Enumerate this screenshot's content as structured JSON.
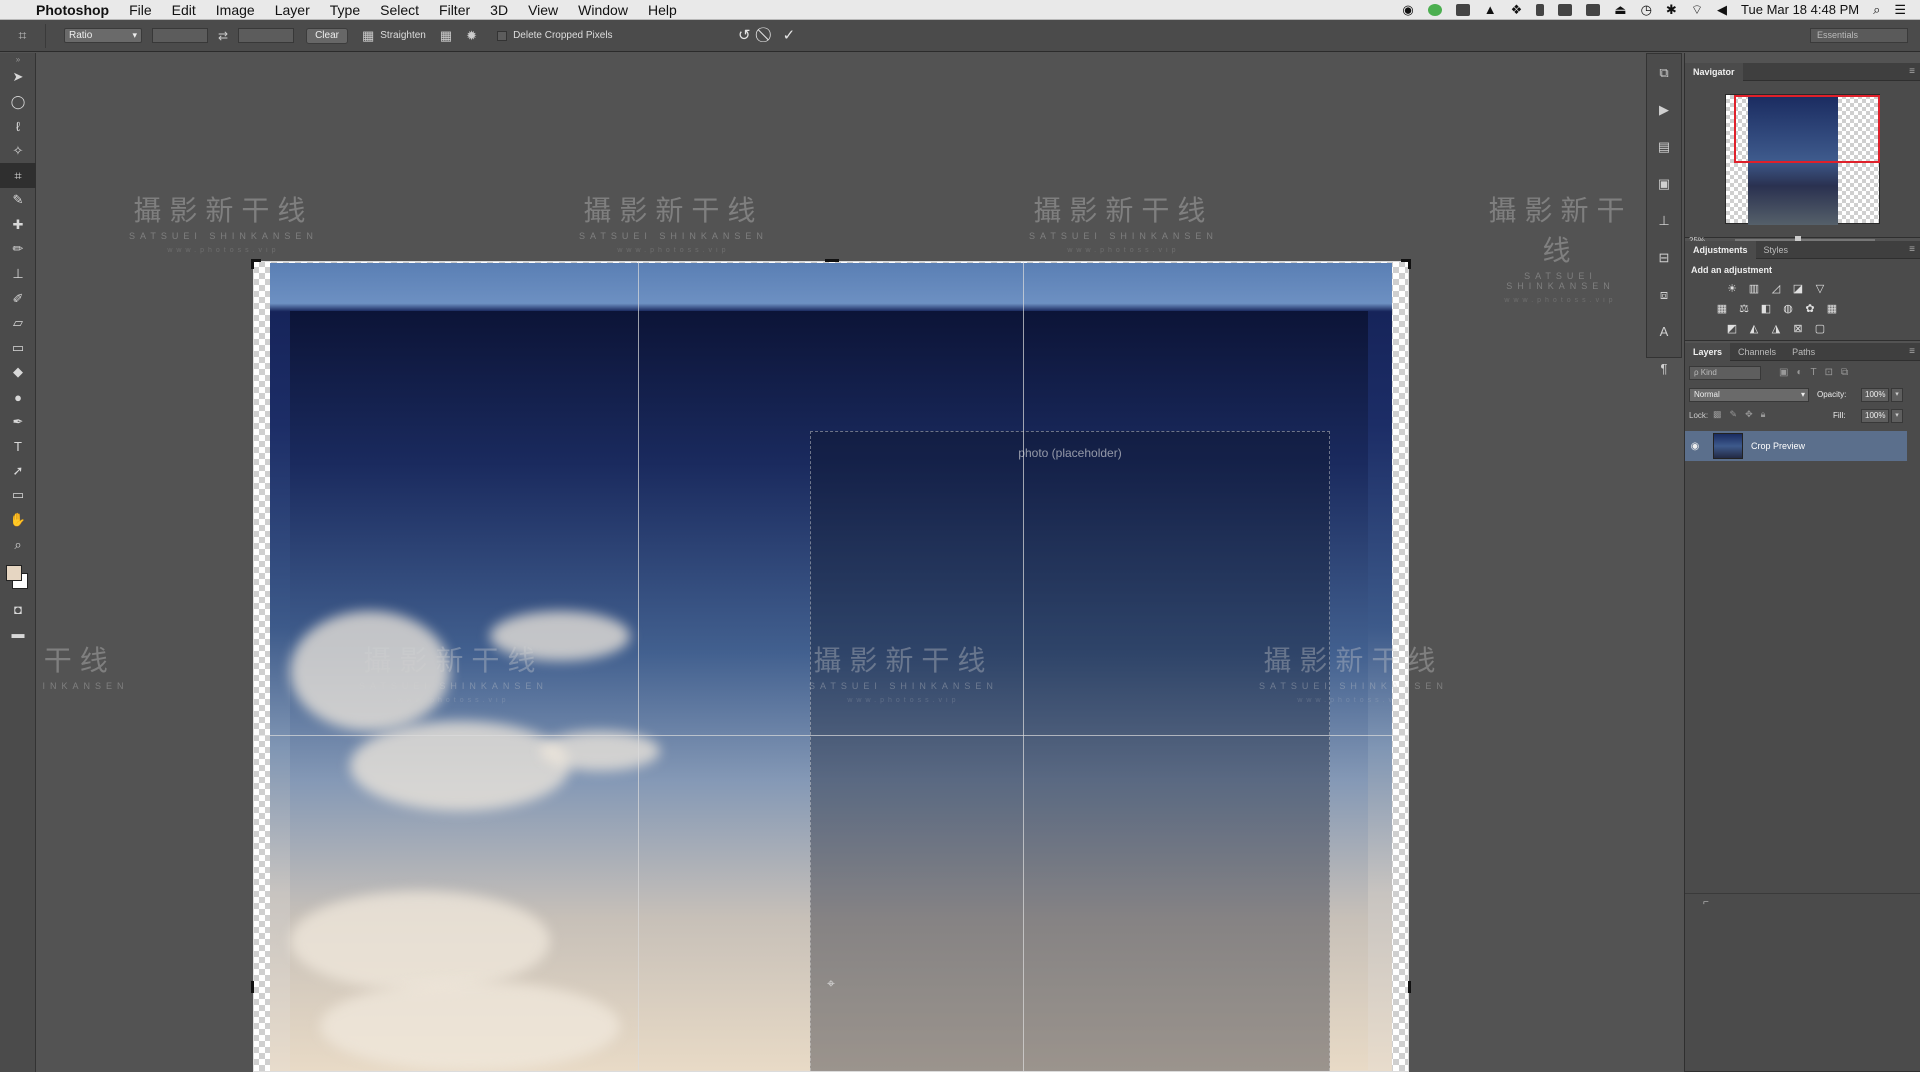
{
  "menubar": {
    "app_name": "Photoshop",
    "items": [
      "File",
      "Edit",
      "Image",
      "Layer",
      "Type",
      "Select",
      "Filter",
      "3D",
      "View",
      "Window",
      "Help"
    ],
    "clock": "Tue Mar 18  4:48 PM"
  },
  "options_bar": {
    "ratio_label": "Ratio",
    "clear_label": "Clear",
    "straighten_label": "Straighten",
    "delete_cropped_label": "Delete Cropped Pixels",
    "workspace_label": "Essentials"
  },
  "watermark": {
    "main": "攝影新干线",
    "sub": "SATSUEI SHINKANSEN",
    "url": "www.photoss.vip",
    "partial_main": "干线",
    "partial_sub": "HINKANSEN"
  },
  "panels": {
    "navigator": {
      "tab": "Navigator",
      "zoom": "25%"
    },
    "adjustments": {
      "tabs": [
        "Adjustments",
        "Styles"
      ],
      "title": "Add an adjustment"
    },
    "layers": {
      "tabs": [
        "Layers",
        "Channels",
        "Paths"
      ],
      "filter_placeholder": "ρ Kind",
      "blend_mode": "Normal",
      "opacity_label": "Opacity:",
      "opacity": "100%",
      "lock_label": "Lock:",
      "fill_label": "Fill:",
      "fill": "100%",
      "layer_name": "Crop Preview"
    }
  },
  "media": {
    "photo_note": "photo (placeholder)"
  },
  "colors": {
    "accent_red": "#e0202a",
    "layer_selected": "#5b6f8c",
    "foreground_swatch": "#e6d6c2"
  }
}
